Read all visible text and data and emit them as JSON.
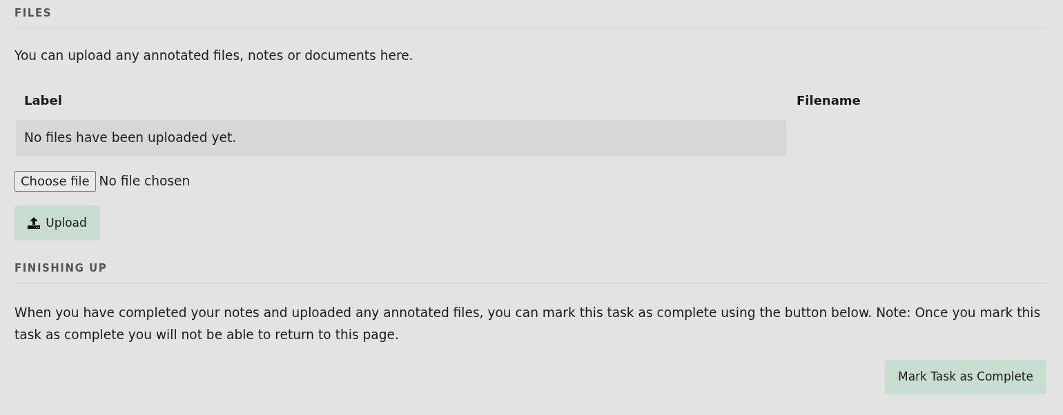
{
  "files_section": {
    "heading": "FILES",
    "description": "You can upload any annotated files, notes or documents here.",
    "table": {
      "columns": [
        "Label",
        "Filename"
      ],
      "empty_message": "No files have been uploaded yet."
    },
    "file_input": {
      "button": "Choose file",
      "status": "No file chosen"
    },
    "upload_button": "Upload"
  },
  "finishing_section": {
    "heading": "FINISHING UP",
    "description": "When you have completed your notes and uploaded any annotated files, you can mark this task as complete using the button below. Note: Once you mark this task as complete you will not be able to return to this page.",
    "complete_button": "Mark Task as Complete"
  }
}
